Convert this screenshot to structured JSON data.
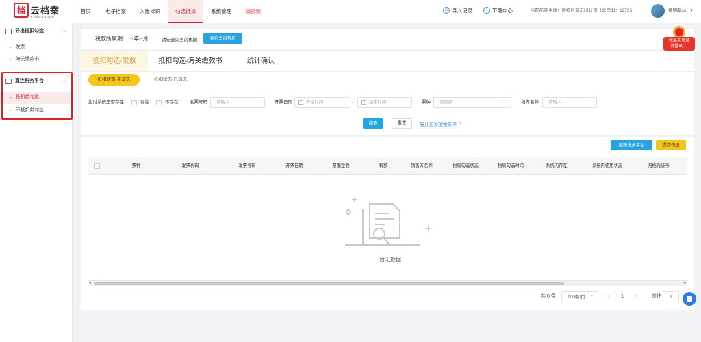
{
  "brand": {
    "logo_text": "云档案",
    "logo_sub": "YUNDANGAN"
  },
  "nav": {
    "items": [
      "首页",
      "电子档案",
      "入账标识",
      "勾选抵扣",
      "系统管理",
      "微报账"
    ]
  },
  "toolbar": {
    "import": "导入记录",
    "download": "下载中心",
    "entity": "当前所在主体：微报账演示HI公司（公司ID：12726）",
    "user": "黄明磊sc"
  },
  "sidebar": {
    "group1": "导出抵扣勾选",
    "group1_items": [
      "发票",
      "海关缴款书"
    ],
    "group2": "直连税务平台",
    "group2_items": [
      "抵扣类勾选",
      "不抵扣类勾选"
    ]
  },
  "period": {
    "label": "税款所属期:",
    "value": "--年--月",
    "hint": "请先查询当前税期",
    "query_btn": "查询当前税期"
  },
  "tax_badge": {
    "line1": "税局未登录",
    "line2": "请登录 〉"
  },
  "tabs": [
    "抵扣勾选-发票",
    "抵扣勾选-海关缴款书",
    "统计确认"
  ],
  "status_pills": [
    "抵扣状态-未勾选",
    "抵扣状态-已勾选"
  ],
  "filters": {
    "exists_label": "比对系统是否存在",
    "exists_opt1": "存在",
    "exists_opt2": "不存在",
    "invoice_no_label": "发票号码",
    "invoice_no_ph": "请输入",
    "date_label": "开票日期",
    "date_start_ph": "开始时间",
    "date_sep": "-",
    "date_end_ph": "结束时间",
    "type_label": "票种",
    "type_ph": "请选择",
    "seller_label": "销方名称",
    "seller_ph": "请输入",
    "search_btn": "搜索",
    "reset_btn": "重置",
    "more": "展开更多搜索条件"
  },
  "actions": {
    "refresh": "更新税务平台",
    "submit": "提交勾选"
  },
  "table": {
    "columns": [
      "票种",
      "发票代码",
      "发票号码",
      "开票日期",
      "票面金额",
      "税额",
      "销售方名称",
      "税局勾选状态",
      "税局勾选时间",
      "系统内存在",
      "系统内使用状态",
      "归档凭证号"
    ],
    "empty": "暂无数据"
  },
  "pager": {
    "total": "共 0 条",
    "size": "100条/页",
    "page": "1",
    "goto": "前往",
    "goto_val": "1",
    "prev": "‹",
    "next": "›"
  },
  "colors": {
    "brand_red": "#d9263b",
    "accent_yellow": "#f5c518",
    "accent_blue": "#25a4e0",
    "link_blue": "#3a8ee6"
  }
}
